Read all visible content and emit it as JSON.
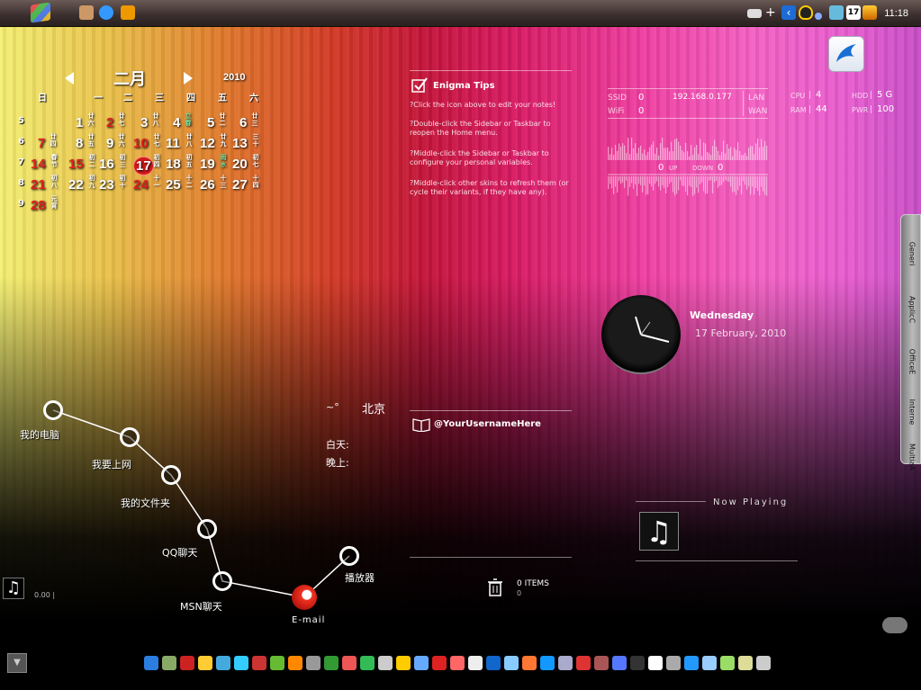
{
  "taskbar": {
    "time": "11:18",
    "tray_icons": [
      "keyboard-icon",
      "plus-icon",
      "back-arrow-icon",
      "qq-penguin-icon",
      "wifi-icon",
      "network-icon",
      "calendar-17-icon",
      "app-icon"
    ],
    "tray_calendar_day": "17"
  },
  "calendar": {
    "month": "二月",
    "year": "2010",
    "weekdays": [
      "日",
      "一",
      "二",
      "三",
      "四",
      "五",
      "六"
    ],
    "weeks": [
      {
        "num": "5",
        "days": [
          {
            "n": "1",
            "s": "廿六"
          },
          {
            "n": "2",
            "s": "廿七",
            "red": true
          },
          {
            "n": "3",
            "s": "廿八"
          },
          {
            "n": "4",
            "s": "立春",
            "green": true
          },
          {
            "n": "5",
            "s": "廿二"
          },
          {
            "n": "6",
            "s": "廿三"
          }
        ]
      },
      {
        "num": "6",
        "days": [
          {
            "n": "7",
            "s": "廿四",
            "red": true
          },
          {
            "n": "8",
            "s": "廿五"
          },
          {
            "n": "9",
            "s": "廿六"
          },
          {
            "n": "10",
            "s": "廿七",
            "red": true
          },
          {
            "n": "11",
            "s": "廿八"
          },
          {
            "n": "12",
            "s": "廿九"
          },
          {
            "n": "13",
            "s": "三十"
          }
        ]
      },
      {
        "num": "7",
        "days": [
          {
            "n": "14",
            "s": "春节",
            "red": true
          },
          {
            "n": "15",
            "s": "初二",
            "red": true
          },
          {
            "n": "16",
            "s": "初三"
          },
          {
            "n": "17",
            "s": "初四",
            "today": true
          },
          {
            "n": "18",
            "s": "初五"
          },
          {
            "n": "19",
            "s": "雨水",
            "green": true
          },
          {
            "n": "20",
            "s": "初七"
          }
        ]
      },
      {
        "num": "8",
        "days": [
          {
            "n": "21",
            "s": "初八",
            "red": true
          },
          {
            "n": "22",
            "s": "初九"
          },
          {
            "n": "23",
            "s": "初十"
          },
          {
            "n": "24",
            "s": "十一",
            "red": true
          },
          {
            "n": "25",
            "s": "十二"
          },
          {
            "n": "26",
            "s": "十三"
          },
          {
            "n": "27",
            "s": "十四"
          }
        ]
      },
      {
        "num": "9",
        "days": [
          {
            "n": "28",
            "s": "元宵",
            "red": true
          }
        ]
      }
    ]
  },
  "tips": {
    "title": "Enigma Tips",
    "lines": [
      "?Click the icon above to edit your notes!",
      "?Double-click the Sidebar or Taskbar to reopen the Home menu.",
      "?Middle-click the Sidebar or Taskbar to configure your personal variables.",
      "?Middle-click other skins to refresh them (or cycle their variants, if they have any)."
    ]
  },
  "network": {
    "ssid_label": "SSID",
    "ssid_value": "0",
    "ip": "192.168.0.177",
    "lan_label": "LAN",
    "wifi_label": "WiFi",
    "wifi_value": "0",
    "wan_label": "WAN",
    "up_value": "0",
    "up_label": "UP",
    "down_label": "DOWN",
    "down_value": "0"
  },
  "system": {
    "cpu_label": "CPU",
    "cpu_value": "4",
    "hdd_label": "HDD",
    "hdd_value": "5 G",
    "ram_label": "RAM",
    "ram_value": "44",
    "pwr_label": "PWR",
    "pwr_value": "100"
  },
  "sidebar_tabs": [
    "Generi",
    "ApplicC",
    "OfficeE",
    "Interne",
    "MultiaA"
  ],
  "clock": {
    "day": "Wednesday",
    "date": "17 February, 2010"
  },
  "weather": {
    "temp": "~°",
    "city": "北京",
    "day_label": "白天:",
    "night_label": "晚上:"
  },
  "twitter": {
    "username": "@YourUsernameHere"
  },
  "shortcuts": [
    {
      "label": "我的电脑"
    },
    {
      "label": "我要上网"
    },
    {
      "label": "我的文件夹"
    },
    {
      "label": "QQ聊天"
    },
    {
      "label": "MSN聊天"
    },
    {
      "label": "E-mail"
    },
    {
      "label": "播放器"
    }
  ],
  "recycle": {
    "items": "0 ITEMS",
    "size": "0"
  },
  "now_playing": {
    "label": "Now Playing"
  },
  "mini_player": {
    "time": "0.00 |"
  },
  "colors": {
    "accent": "#e81a6a",
    "today": "#d01818",
    "green": "#6fe0a0"
  },
  "dock_icons": [
    "recycle-icon",
    "app-icon",
    "red-ball-icon",
    "smiley-icon",
    "globe-icon",
    "k-icon",
    "qq-icon",
    "chrome-icon",
    "mail-icon",
    "eye-icon",
    "leaf-icon",
    "red-app-icon",
    "green-refresh-icon",
    "photo-icon",
    "yellow-app-icon",
    "font-icon",
    "media-play-icon",
    "spiral-icon",
    "runner-icon",
    "back-icon",
    "flower-icon",
    "orange-icon",
    "blue-app-icon",
    "document-icon",
    "red-icon",
    "gem-icon",
    "bottle-icon",
    "dark-app-icon",
    "panda-icon",
    "skull-icon",
    "ie-icon",
    "drop-icon",
    "face-icon",
    "pen-icon",
    "car-icon"
  ]
}
